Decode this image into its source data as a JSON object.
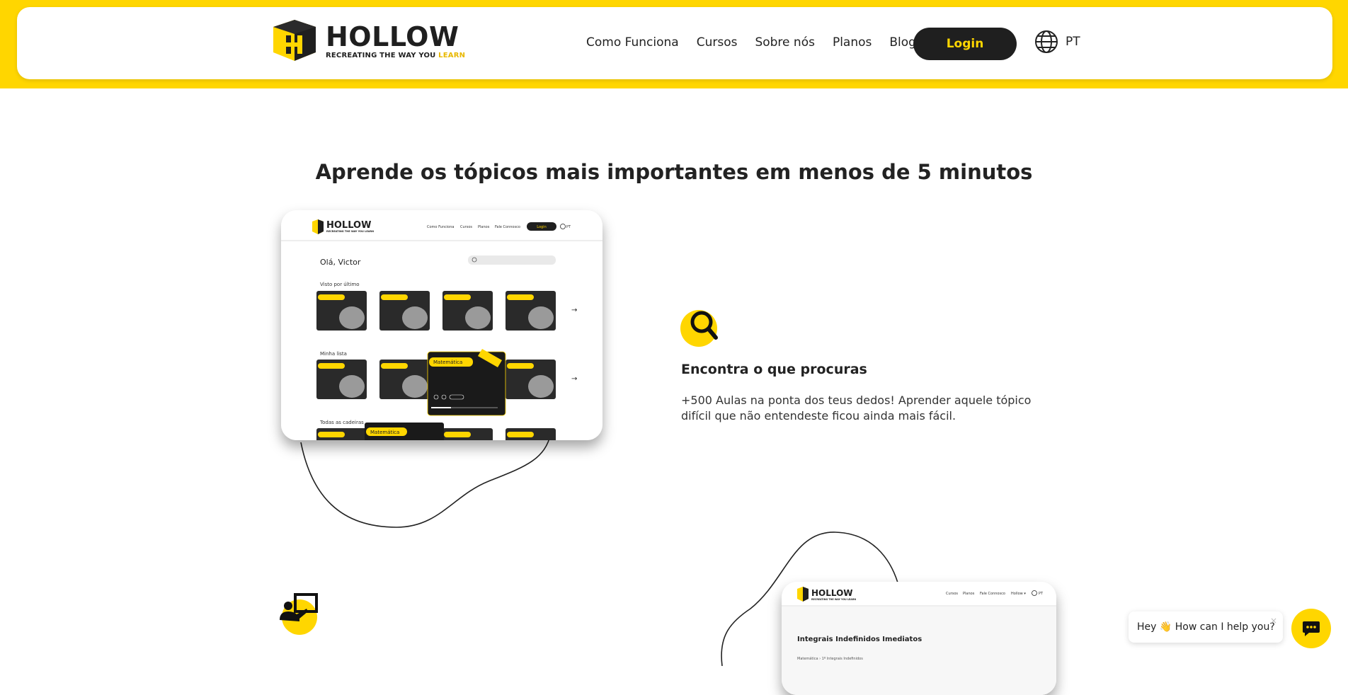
{
  "header": {
    "logo_word": "HOLLOW",
    "logo_tagline": "RECREATING THE WAY YOU",
    "logo_tagline_highlight": "LEARN",
    "nav": [
      "Como Funciona",
      "Cursos",
      "Sobre nós",
      "Planos",
      "Blog"
    ],
    "login_label": "Login",
    "language": "PT"
  },
  "section": {
    "title": "Aprende os tópicos mais importantes em menos de 5 minutos"
  },
  "mockup1": {
    "nav": [
      "Como Funciona",
      "Cursos",
      "Planos",
      "Fale Connosco"
    ],
    "login": "Login",
    "lang": "PT",
    "greeting": "Olá, Victor",
    "rows": [
      "Visto por último",
      "Minha lista",
      "Todas as cadeiras"
    ],
    "card_tag": "Matemática",
    "popup_tag": "Matemática",
    "row3_tag": "Matemática"
  },
  "feature1": {
    "icon": "search-icon",
    "title": "Encontra o que procuras",
    "description": "+500 Aulas na ponta dos teus dedos! Aprender aquele tópico difícil que não entendeste ficou ainda mais fácil."
  },
  "feature2": {
    "icon": "presentation-icon"
  },
  "mockup2": {
    "nav": [
      "Cursos",
      "Planos",
      "Fale Connosco",
      "Hollow",
      "PT"
    ],
    "title": "Integrais Indefinidos Imediatos",
    "breadcrumb": "Matemática › 1º Integrais Indefinidos"
  },
  "chat": {
    "message": "Hey 👋 How can I help you?",
    "close": "×"
  },
  "colors": {
    "brand_yellow": "#FFD600",
    "dark": "#1f1f1f"
  }
}
